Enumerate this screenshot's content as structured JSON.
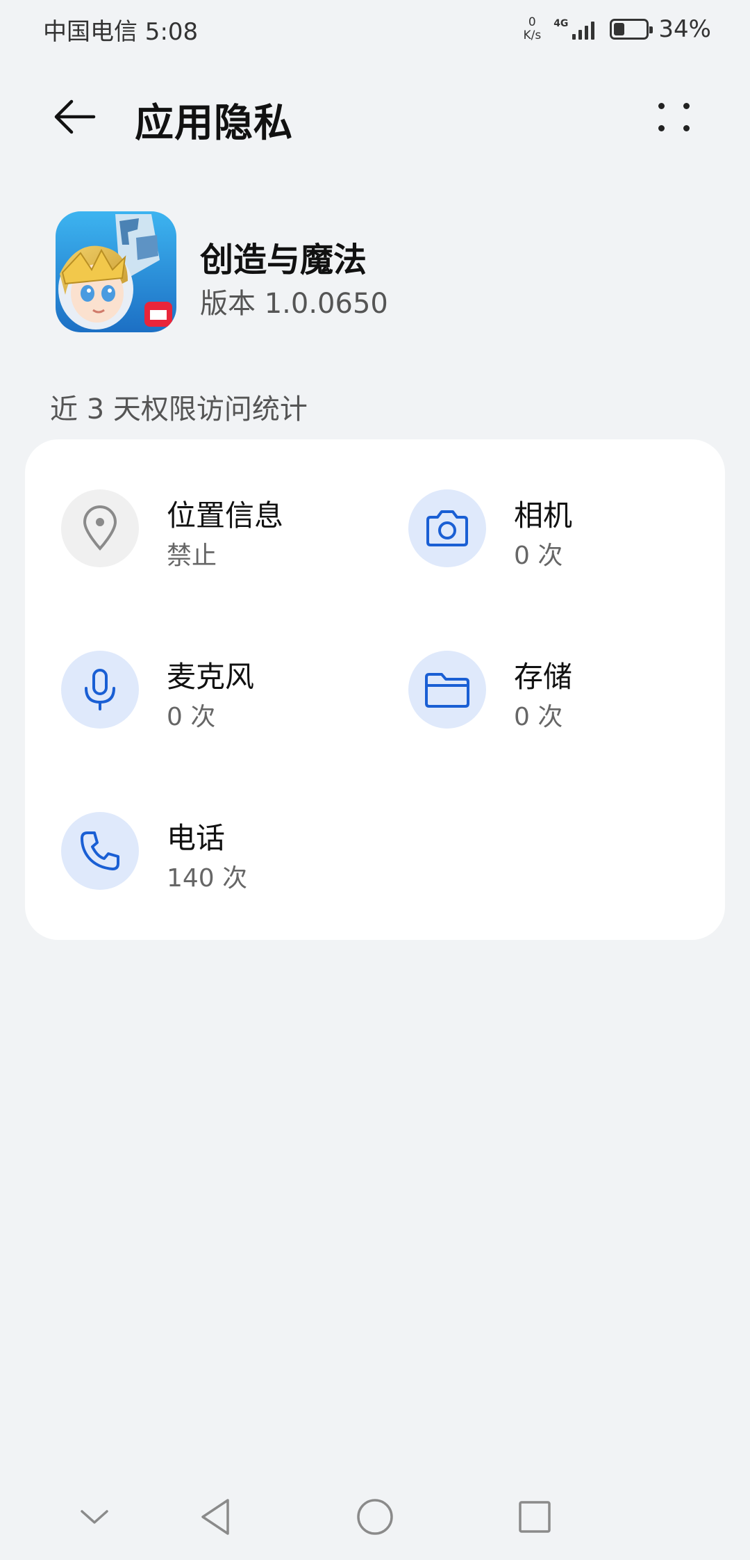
{
  "status_bar": {
    "carrier_time": "中国电信 5:08",
    "net_speed_value": "0",
    "net_speed_unit": "K/s",
    "network_type": "4G",
    "battery_percent": "34%",
    "battery_level": 0.34
  },
  "title_bar": {
    "title": "应用隐私",
    "back_icon": "arrow-left-icon",
    "more_icon": "more-dots-icon"
  },
  "app": {
    "name": "创造与魔法",
    "version": "版本 1.0.0650"
  },
  "section_label": "近 3 天权限访问统计",
  "permissions": [
    {
      "name": "位置信息",
      "value": "禁止",
      "icon": "location-pin-icon",
      "enabled": false
    },
    {
      "name": "相机",
      "value": "0 次",
      "icon": "camera-icon",
      "enabled": true
    },
    {
      "name": "麦克风",
      "value": "0 次",
      "icon": "microphone-icon",
      "enabled": true
    },
    {
      "name": "存储",
      "value": "0 次",
      "icon": "folder-icon",
      "enabled": true
    },
    {
      "name": "电话",
      "value": "140 次",
      "icon": "phone-icon",
      "enabled": true
    }
  ],
  "colors": {
    "accent": "#1a5fd4",
    "icon_bg": "#dfe9fb",
    "disabled_icon": "#8a8a8a",
    "background": "#f1f3f5"
  },
  "nav_bar": {
    "icons": [
      "chevron-down-icon",
      "back-triangle-icon",
      "home-circle-icon",
      "recents-square-icon"
    ]
  }
}
